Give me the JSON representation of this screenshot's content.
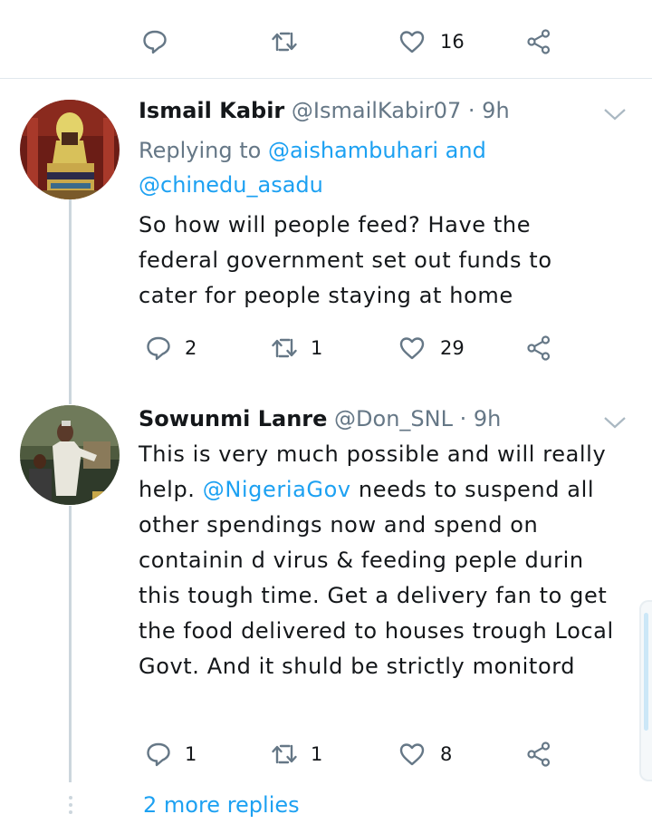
{
  "top_actions": {
    "reply_count": "",
    "retweet_count": "",
    "like_count": "16"
  },
  "tweets": [
    {
      "name": "Ismail Kabir",
      "handle": "@IsmailKabir07",
      "separator": "·",
      "time": "9h",
      "replying_prefix": "Replying to ",
      "replying_mention_1": "@aishambuhari",
      "replying_and": " and",
      "replying_mention_2": "@chinedu_asadu",
      "text": "So how will people feed? Have the federal government set out funds to cater for people staying at home",
      "reply_count": "2",
      "retweet_count": "1",
      "like_count": "29"
    },
    {
      "name": "Sowunmi Lanre",
      "handle": "@Don_SNL",
      "separator": "·",
      "time": "9h",
      "text_before": "This is very much possible and will really help. ",
      "text_mention": "@NigeriaGov",
      "text_after": " needs to suspend all other spendings now and  spend on containin d virus & feeding peple durin this tough time. Get a delivery fan to get the food delivered to houses trough Local Govt. And it shuld be strictly monitord",
      "reply_count": "1",
      "retweet_count": "1",
      "like_count": "8"
    }
  ],
  "more_replies_label": "2 more replies",
  "colors": {
    "link": "#1da1f2",
    "muted": "#657786",
    "text": "#14171a",
    "line": "#ccd6dd",
    "icon": "#657786"
  },
  "icons": [
    "reply-icon",
    "retweet-icon",
    "like-icon",
    "share-icon",
    "chevron-down-icon"
  ]
}
